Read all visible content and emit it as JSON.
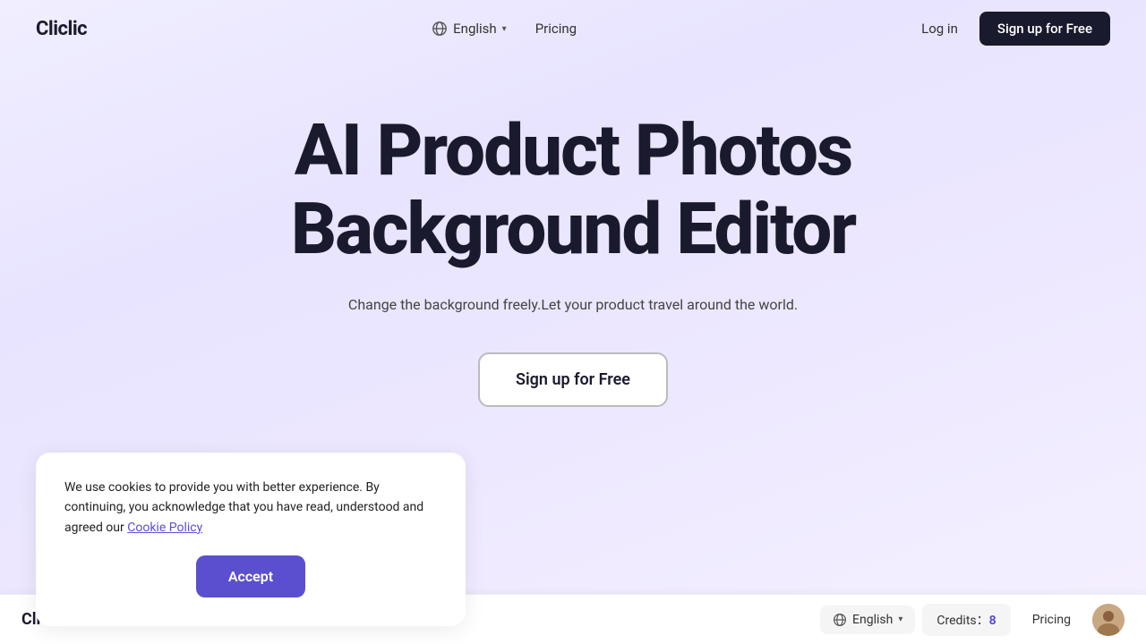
{
  "brand": {
    "name": "Cliclic"
  },
  "navbar": {
    "lang_label": "English",
    "nav_links": [
      {
        "label": "Pricing",
        "id": "pricing"
      }
    ],
    "login_label": "Log in",
    "signup_label": "Sign up for Free"
  },
  "hero": {
    "title_line1": "AI Product Photos",
    "title_line2": "Background Editor",
    "subtitle": "Change the background freely.Let your product travel around the world.",
    "cta_label": "Sign up for Free"
  },
  "cookie_banner": {
    "message": "We use cookies to provide you with better experience. By continuing, you acknowledge that you have read, understood and agreed our ",
    "link_text": "Cookie Policy",
    "accept_label": "Accept"
  },
  "bottom_bar": {
    "logo": "Cliclic",
    "lang_label": "English",
    "credits_label": "Credits：",
    "credits_count": "8",
    "pricing_label": "Pricing"
  },
  "icons": {
    "globe": "🌐",
    "chevron_down": "▾",
    "avatar": "👤"
  }
}
